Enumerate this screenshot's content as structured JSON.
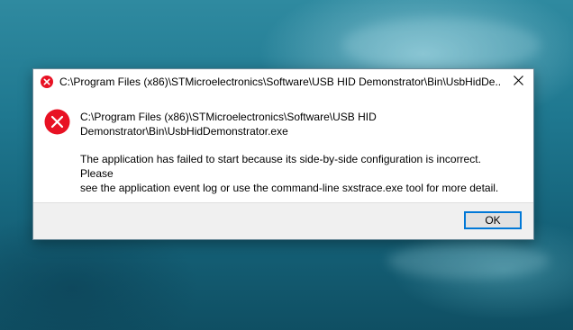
{
  "dialog": {
    "title": "C:\\Program Files (x86)\\STMicroelectronics\\Software\\USB HID Demonstrator\\Bin\\UsbHidDe...",
    "close_icon": "close-icon",
    "error_icon": "error-icon",
    "path_line1": "C:\\Program Files (x86)\\STMicroelectronics\\Software\\USB HID",
    "path_line2": "Demonstrator\\Bin\\UsbHidDemonstrator.exe",
    "message_line1": "The application has failed to start because its side-by-side configuration is incorrect. Please",
    "message_line2": "see the application event log or use the command-line sxstrace.exe tool for more detail.",
    "ok_label": "OK"
  },
  "colors": {
    "error_red": "#e81123",
    "accent_blue": "#0078d7",
    "desktop_teal": "#1f7890"
  }
}
